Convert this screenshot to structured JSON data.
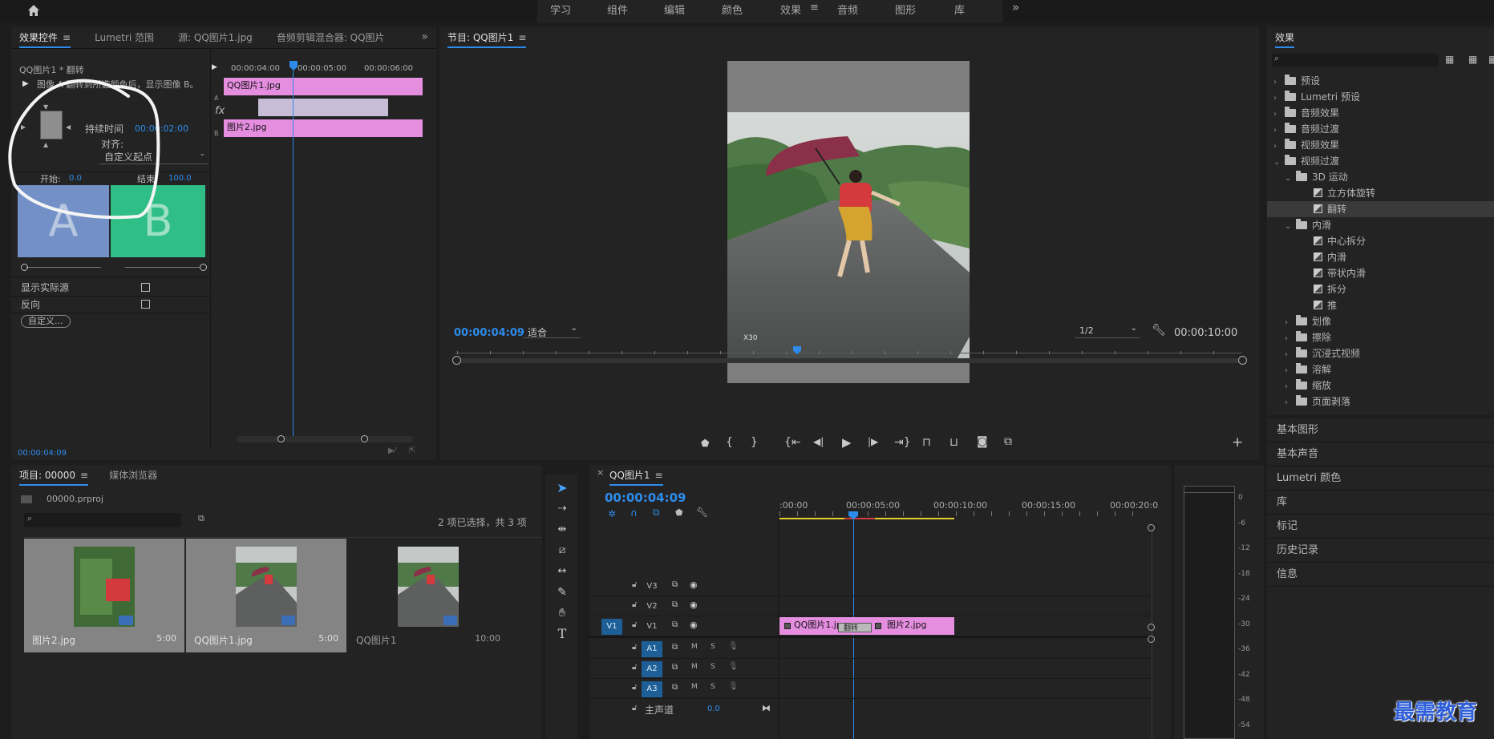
{
  "topnav": {
    "items": [
      "学习",
      "组件",
      "编辑",
      "颜色",
      "效果",
      "音频",
      "图形",
      "库"
    ],
    "active": "效果",
    "more": "»"
  },
  "effect_controls": {
    "tabs": [
      "效果控件",
      "Lumetri 范围",
      "源: QQ图片1.jpg",
      "音频剪辑混合器: QQ图片"
    ],
    "header": "QQ图片1 * 翻转",
    "times": [
      "00:00:04:00",
      "00:00:05:00",
      "00:00:06:00"
    ],
    "desc": "图像 A 翻转到所选颜色后，显示图像 B。",
    "duration_label": "持续时间",
    "duration_value": "00:00:02:00",
    "align_label": "对齐:",
    "align_value": "自定义起点",
    "start_label": "开始:",
    "start_value": "0.0",
    "end_label": "结束:",
    "end_value": "100.0",
    "preview_a": "A",
    "preview_b": "B",
    "show_source": "显示实际源",
    "reverse": "反向",
    "custom_button": "自定义...",
    "clip_a": "QQ图片1.jpg",
    "clip_b": "图片2.jpg",
    "track_a": "A",
    "track_b": "B",
    "fx": "fx",
    "footer_time": "00:00:04:09"
  },
  "program": {
    "title": "节目: QQ图片1",
    "timecode": "00:00:04:09",
    "fit": "适合",
    "quality": "1/2",
    "duration": "00:00:10:00",
    "watermark": "X30"
  },
  "effects_panel": {
    "title": "效果",
    "items": [
      {
        "label": "预设",
        "kind": "folder",
        "indent": 0
      },
      {
        "label": "Lumetri 预设",
        "kind": "folder",
        "indent": 0
      },
      {
        "label": "音频效果",
        "kind": "folder",
        "indent": 0
      },
      {
        "label": "音频过渡",
        "kind": "folder",
        "indent": 0
      },
      {
        "label": "视频效果",
        "kind": "folder",
        "indent": 0
      },
      {
        "label": "视频过渡",
        "kind": "folder",
        "indent": 0,
        "open": true
      },
      {
        "label": "3D 运动",
        "kind": "folder",
        "indent": 1,
        "open": true
      },
      {
        "label": "立方体旋转",
        "kind": "trans",
        "indent": 2
      },
      {
        "label": "翻转",
        "kind": "trans",
        "indent": 2,
        "selected": true
      },
      {
        "label": "内滑",
        "kind": "folder",
        "indent": 1,
        "open": true
      },
      {
        "label": "中心拆分",
        "kind": "trans",
        "indent": 2
      },
      {
        "label": "内滑",
        "kind": "trans",
        "indent": 2
      },
      {
        "label": "带状内滑",
        "kind": "trans",
        "indent": 2
      },
      {
        "label": "拆分",
        "kind": "trans",
        "indent": 2
      },
      {
        "label": "推",
        "kind": "trans",
        "indent": 2
      },
      {
        "label": "划像",
        "kind": "folder",
        "indent": 1
      },
      {
        "label": "擦除",
        "kind": "folder",
        "indent": 1
      },
      {
        "label": "沉浸式视频",
        "kind": "folder",
        "indent": 1
      },
      {
        "label": "溶解",
        "kind": "folder",
        "indent": 1
      },
      {
        "label": "缩放",
        "kind": "folder",
        "indent": 1
      },
      {
        "label": "页面剥落",
        "kind": "folder",
        "indent": 1
      }
    ],
    "sections": [
      "基本图形",
      "基本声音",
      "Lumetri 颜色",
      "库",
      "标记",
      "历史记录",
      "信息"
    ]
  },
  "project": {
    "tabs": [
      "项目: 00000",
      "媒体浏览器"
    ],
    "file": "00000.prproj",
    "selection": "2 项已选择，共 3 项",
    "items": [
      {
        "name": "图片2.jpg",
        "duration": "5:00"
      },
      {
        "name": "QQ图片1.jpg",
        "duration": "5:00"
      },
      {
        "name": "QQ图片1",
        "duration": "10:00"
      }
    ]
  },
  "timeline": {
    "title": "QQ图片1",
    "timecode": "00:00:04:09",
    "ruler": [
      ":00:00",
      "00:00:05:00",
      "00:00:10:00",
      "00:00:15:00",
      "00:00:20:0"
    ],
    "video_tracks": [
      "V3",
      "V2",
      "V1"
    ],
    "audio_tracks": [
      "A1",
      "A2",
      "A3"
    ],
    "source_patch": "V1",
    "master": "主声道",
    "master_value": "0.0",
    "m": "M",
    "s": "S",
    "clip1": "QQ图片1.jpg",
    "transition": "翻转",
    "clip2": "图片2.jpg"
  },
  "meter": {
    "labels": [
      "0",
      "-6",
      "-12",
      "-18",
      "-24",
      "-30",
      "-36",
      "-42",
      "-48",
      "-54"
    ]
  },
  "watermark": "最需教育"
}
